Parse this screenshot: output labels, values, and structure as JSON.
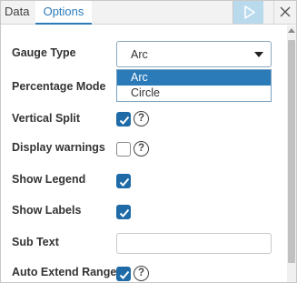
{
  "tabs": {
    "data": "Data",
    "options": "Options"
  },
  "header": {
    "run_icon": "play-icon",
    "close_icon": "close-icon"
  },
  "options": {
    "gauge_type": {
      "label": "Gauge Type",
      "value": "Arc",
      "dropdown_options": [
        "Arc",
        "Circle"
      ],
      "selected_index": 0
    },
    "percentage_mode": {
      "label": "Percentage Mode"
    },
    "vertical_split": {
      "label": "Vertical Split",
      "checked": true,
      "help": "?"
    },
    "display_warnings": {
      "label": "Display warnings",
      "checked": false,
      "help": "?"
    },
    "show_legend": {
      "label": "Show Legend",
      "checked": true
    },
    "show_labels": {
      "label": "Show Labels",
      "checked": true
    },
    "sub_text": {
      "label": "Sub Text",
      "value": "",
      "placeholder": ""
    },
    "auto_extend_range": {
      "label": "Auto Extend Range",
      "checked": true,
      "help": "?"
    }
  },
  "colors": {
    "accent": "#2b7bb9",
    "checkbox_on": "#1e6ba8",
    "run_button_bg": "#b9d9ec"
  }
}
